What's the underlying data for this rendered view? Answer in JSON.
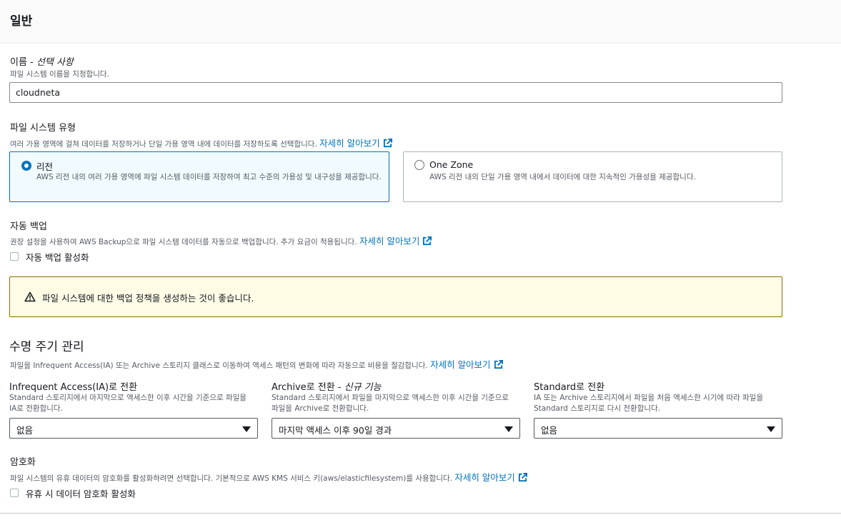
{
  "section": {
    "title": "일반"
  },
  "name": {
    "label": "이름 - ",
    "optional": "선택 사항",
    "description": "파일 시스템 이름을 지정합니다.",
    "value": "cloudneta"
  },
  "file_system_type": {
    "label": "파일 시스템 유형",
    "description": "여러 가용 영역에 걸쳐 데이터를 저장하거나 단일 가용 영역 내에 데이터를 저장하도록 선택합니다.",
    "learn_more": "자세히 알아보기",
    "options": [
      {
        "title": "리전",
        "description": "AWS 리전 내의 여러 가용 영역에 파일 시스템 데이터를 저장하여 최고 수준의 가용성 및 내구성을 제공합니다.",
        "selected": true
      },
      {
        "title": "One Zone",
        "description": "AWS 리전 내의 단일 가용 영역 내에서 데이터에 대한 지속적인 가용성을 제공합니다.",
        "selected": false
      }
    ]
  },
  "backup": {
    "label": "자동 백업",
    "description": "권장 설정을 사용하여 AWS Backup으로 파일 시스템 데이터를 자동으로 백업합니다. 추가 요금이 적용됩니다.",
    "learn_more": "자세히 알아보기",
    "checkbox_label": "자동 백업 활성화",
    "checked": false,
    "warning": "파일 시스템에 대한 백업 정책을 생성하는 것이 좋습니다."
  },
  "lifecycle": {
    "heading": "수명 주기 관리",
    "description": "파일을 Infrequent Access(IA) 또는 Archive 스토리지 클래스로 이동하여 액세스 패턴의 변화에 따라 자동으로 비용을 절감합니다.",
    "learn_more": "자세히 알아보기",
    "columns": [
      {
        "label": "Infrequent Access(IA)로 전환",
        "label_suffix": "",
        "description": "Standard 스토리지에서 마지막으로 액세스한 이후 시간을 기준으로 파일을 IA로 전환합니다.",
        "value": "없음"
      },
      {
        "label": "Archive로 전환 - ",
        "label_suffix": "신규 기능",
        "description": "Standard 스토리지에서 파일을 마지막으로 액세스한 이후 시간을 기준으로 파일을 Archive로 전환합니다.",
        "value": "마지막 액세스 이후 90일 경과"
      },
      {
        "label": "Standard로 전환",
        "label_suffix": "",
        "description": "IA 또는 Archive 스토리지에서 파일을 처음 액세스한 시기에 따라 파일을 Standard 스토리지로 다시 전환합니다.",
        "value": "없음"
      }
    ]
  },
  "encryption": {
    "label": "암호화",
    "description": "파일 시스템의 유휴 데이터의 암호화를 활성화하려면 선택합니다. 기본적으로 AWS KMS 서비스 키(aws/elasticfilesystem)를 사용합니다.",
    "learn_more": "자세히 알아보기",
    "checkbox_label": "유휴 시 데이터 암호화 활성화",
    "checked": false
  },
  "colors": {
    "link": "#0073bb",
    "warning_bg": "#fffce6",
    "warning_border": "#8a6b05",
    "selected_tile_bg": "#f1faff"
  },
  "icons": {
    "external_link": "external-link-icon",
    "warning": "warning-icon"
  }
}
